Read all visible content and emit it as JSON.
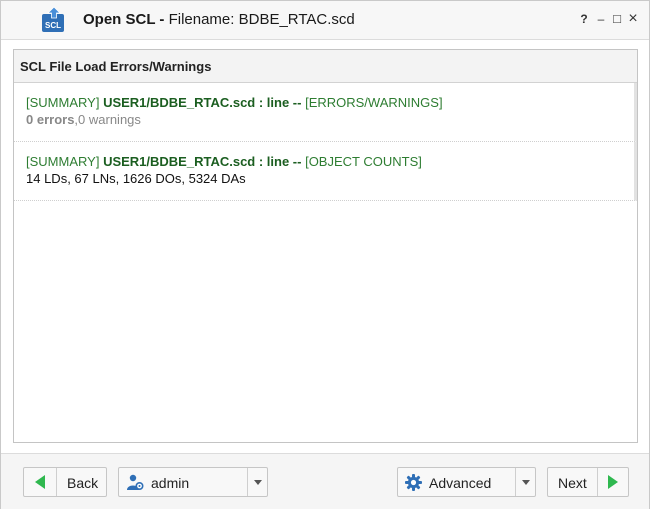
{
  "window": {
    "title_strong": "Open SCL -",
    "title_rest": " Filename: BDBE_RTAC.scd",
    "help_label": "?",
    "minimize_label": "–",
    "maximize_label": "□",
    "close_label": "×",
    "app_icon_text": "SCL"
  },
  "panel": {
    "title": "SCL File Load Errors/Warnings",
    "messages": [
      {
        "prefix": "[SUMMARY] ",
        "file": "USER1/BDBE_RTAC.scd : line --",
        "tag": " [ERRORS/WARNINGS]",
        "detail_a": "0 errors",
        "detail_b": ",0 warnings"
      },
      {
        "prefix": "[SUMMARY] ",
        "file": "USER1/BDBE_RTAC.scd : line --",
        "tag": " [OBJECT COUNTS]",
        "detail": "14 LDs, 67 LNs, 1626 DOs, 5324 DAs"
      }
    ]
  },
  "footer": {
    "back_label": "Back",
    "user_label": "admin",
    "advanced_label": "Advanced",
    "next_label": "Next"
  },
  "colors": {
    "accent_green": "#2fb84f",
    "message_green": "#2e7d32",
    "icon_blue": "#2f6fb6"
  }
}
